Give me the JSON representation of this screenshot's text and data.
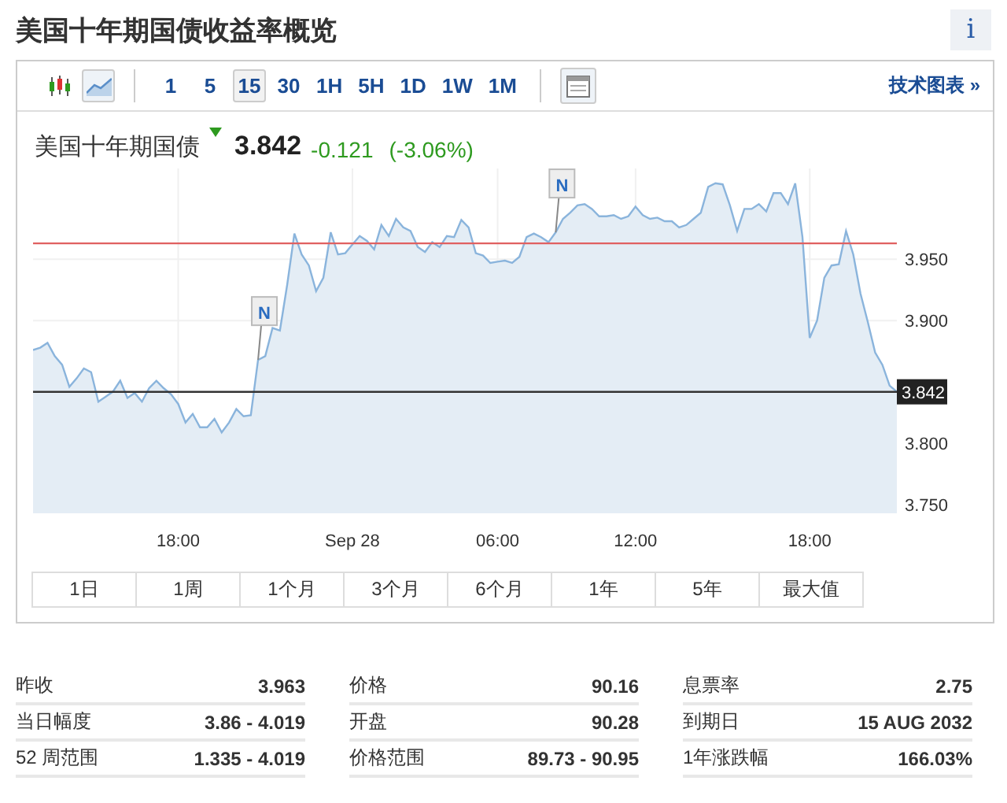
{
  "title": "美国十年期国债收益率概览",
  "info_button": "i",
  "toolbar": {
    "chart_types": [
      {
        "kind": "candlestick",
        "selected": false
      },
      {
        "kind": "line",
        "selected": true
      }
    ],
    "intervals": [
      {
        "label": "1",
        "selected": false
      },
      {
        "label": "5",
        "selected": false
      },
      {
        "label": "15",
        "selected": true
      },
      {
        "label": "30",
        "selected": false
      },
      {
        "label": "1H",
        "selected": false
      },
      {
        "label": "5H",
        "selected": false
      },
      {
        "label": "1D",
        "selected": false
      },
      {
        "label": "1W",
        "selected": false
      },
      {
        "label": "1M",
        "selected": false
      }
    ],
    "link": "技术图表 »"
  },
  "quote": {
    "name": "美国十年期国债",
    "falling": true,
    "price": "3.842",
    "change": "-0.121",
    "change_percent": "(-3.06%)"
  },
  "chart_data": {
    "type": "area",
    "grid": true,
    "ylim": [
      3.743,
      4.024
    ],
    "yticks": [
      {
        "value": 3.75,
        "label": "3.750"
      },
      {
        "value": 3.8,
        "label": "3.800"
      },
      {
        "value": 3.9,
        "label": "3.900"
      },
      {
        "value": 3.95,
        "label": "3.950"
      }
    ],
    "categories": [
      null,
      null,
      null,
      null,
      null,
      null,
      null,
      null,
      null,
      null,
      null,
      null,
      null,
      null,
      null,
      null,
      null,
      null,
      null,
      null,
      "18:00",
      null,
      null,
      null,
      null,
      null,
      null,
      null,
      null,
      null,
      null,
      null,
      null,
      null,
      null,
      null,
      null,
      null,
      null,
      null,
      null,
      null,
      null,
      null,
      "Sep 28",
      null,
      null,
      null,
      null,
      null,
      null,
      null,
      null,
      null,
      null,
      null,
      null,
      null,
      null,
      null,
      null,
      null,
      null,
      null,
      "06:00",
      null,
      null,
      null,
      null,
      null,
      null,
      null,
      null,
      null,
      null,
      null,
      null,
      null,
      null,
      null,
      null,
      null,
      null,
      "12:00",
      null,
      null,
      null,
      null,
      null,
      null,
      null,
      null,
      null,
      null,
      null,
      null,
      null,
      null,
      null,
      null,
      null,
      null,
      null,
      null,
      null,
      null,
      null,
      "18:00",
      null,
      null,
      null,
      null,
      null,
      null,
      null,
      null,
      null,
      null,
      null,
      null
    ],
    "series": [
      {
        "color": "#8ab4dc",
        "values": [
          3.876,
          3.878,
          3.882,
          3.871,
          3.864,
          3.846,
          3.853,
          3.861,
          3.858,
          3.834,
          3.838,
          3.842,
          3.851,
          3.837,
          3.841,
          3.834,
          3.845,
          3.851,
          3.845,
          3.84,
          3.832,
          3.817,
          3.824,
          3.813,
          3.813,
          3.82,
          3.809,
          3.817,
          3.828,
          3.822,
          3.823,
          3.868,
          3.871,
          3.894,
          3.892,
          3.929,
          3.971,
          3.954,
          3.945,
          3.924,
          3.935,
          3.972,
          3.954,
          3.955,
          3.962,
          3.969,
          3.965,
          3.958,
          3.978,
          3.969,
          3.983,
          3.976,
          3.973,
          3.96,
          3.956,
          3.964,
          3.96,
          3.969,
          3.968,
          3.982,
          3.976,
          3.955,
          3.953,
          3.947,
          3.948,
          3.949,
          3.947,
          3.952,
          3.968,
          3.971,
          3.968,
          3.964,
          3.972,
          3.983,
          3.988,
          3.994,
          3.995,
          3.991,
          3.985,
          3.985,
          3.986,
          3.983,
          3.985,
          3.993,
          3.986,
          3.983,
          3.984,
          3.981,
          3.981,
          3.976,
          3.978,
          3.983,
          3.988,
          4.009,
          4.012,
          4.011,
          3.994,
          3.973,
          3.991,
          3.991,
          3.995,
          3.989,
          4.004,
          4.004,
          3.995,
          4.012,
          3.968,
          3.886,
          3.9,
          3.935,
          3.945,
          3.946,
          3.973,
          3.954,
          3.922,
          3.899,
          3.874,
          3.864,
          3.847,
          3.842
        ]
      }
    ],
    "ref_lines": [
      {
        "axis": "y",
        "value": 3.963,
        "color": "#e06060"
      },
      {
        "axis": "y",
        "value": 3.842,
        "color": "#333333",
        "label": "3.842"
      }
    ],
    "annotations": [
      {
        "text": "N"
      },
      {
        "text": "N"
      }
    ]
  },
  "ranges": [
    {
      "label": "1日",
      "selected": false
    },
    {
      "label": "1周",
      "selected": false
    },
    {
      "label": "1个月",
      "selected": false
    },
    {
      "label": "3个月",
      "selected": false
    },
    {
      "label": "6个月",
      "selected": false
    },
    {
      "label": "1年",
      "selected": false
    },
    {
      "label": "5年",
      "selected": false
    },
    {
      "label": "最大值",
      "selected": false
    }
  ],
  "stats": [
    [
      {
        "label": "昨收",
        "value": "3.963"
      },
      {
        "label": "当日幅度",
        "value": "3.86 - 4.019"
      },
      {
        "label": "52 周范围",
        "value": "1.335 - 4.019"
      }
    ],
    [
      {
        "label": "价格",
        "value": "90.16"
      },
      {
        "label": "开盘",
        "value": "90.28"
      },
      {
        "label": "价格范围",
        "value": "89.73 - 90.95"
      }
    ],
    [
      {
        "label": "息票率",
        "value": "2.75"
      },
      {
        "label": "到期日",
        "value": "15 AUG 2032"
      },
      {
        "label": "1年涨跌幅",
        "value": "166.03%"
      }
    ]
  ]
}
